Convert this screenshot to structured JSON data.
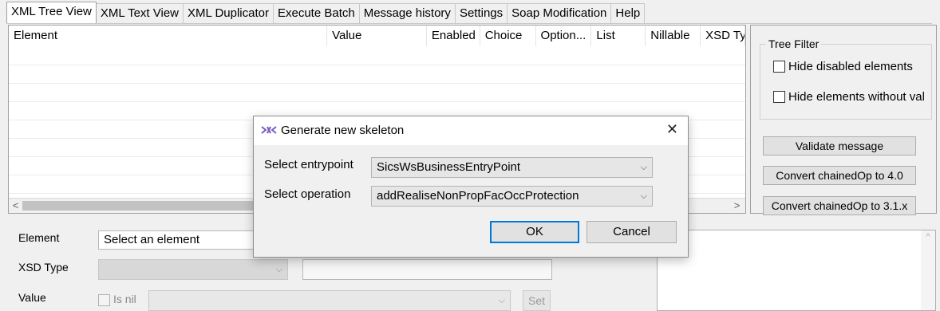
{
  "tabs": [
    {
      "label": "XML Tree View",
      "active": true
    },
    {
      "label": "XML Text View"
    },
    {
      "label": "XML Duplicator"
    },
    {
      "label": "Execute Batch"
    },
    {
      "label": "Message history"
    },
    {
      "label": "Settings"
    },
    {
      "label": "Soap Modification"
    },
    {
      "label": "Help"
    }
  ],
  "table": {
    "columns": [
      "Element",
      "Value",
      "Enabled",
      "Choice",
      "Option...",
      "List",
      "Nillable",
      "XSD Ty"
    ]
  },
  "right_panel": {
    "filter_title": "Tree Filter",
    "hide_disabled": "Hide disabled elements",
    "hide_without_value": "Hide elements without val",
    "validate_label": "Validate message",
    "convert_40_label": "Convert chainedOp to 4.0",
    "convert_31_label": "Convert chainedOp to 3.1.x"
  },
  "form": {
    "element_label": "Element",
    "element_value": "Select an element",
    "xsd_type_label": "XSD Type",
    "value_label": "Value",
    "is_nil_label": "Is nil",
    "set_label": "Set"
  },
  "dialog": {
    "title": "Generate new skeleton",
    "entrypoint_label": "Select entrypoint",
    "entrypoint_value": "SicsWsBusinessEntryPoint",
    "operation_label": "Select operation",
    "operation_value": "addRealiseNonPropFacOccProtection",
    "ok_label": "OK",
    "cancel_label": "Cancel",
    "close_glyph": "✕"
  },
  "icons": {
    "left_arrow": "<",
    "right_arrow": ">",
    "chevron_down": "⌵",
    "up_arrow": "^"
  },
  "colors": {
    "accent": "#0078d7",
    "dialog_icon": "#7a5bbf"
  }
}
